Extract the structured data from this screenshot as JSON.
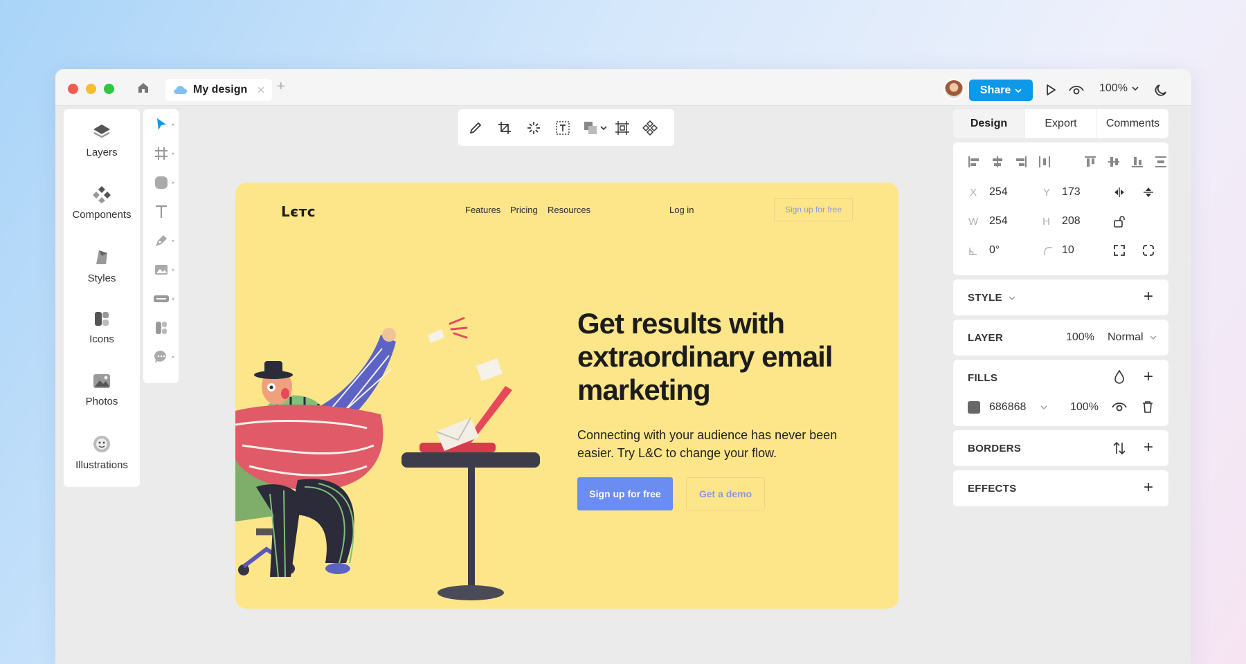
{
  "titlebar": {
    "tab_title": "My design",
    "share_label": "Share",
    "zoom": "100%"
  },
  "left_panel": {
    "items": [
      {
        "label": "Layers",
        "icon": "layers-icon"
      },
      {
        "label": "Components",
        "icon": "components-icon"
      },
      {
        "label": "Styles",
        "icon": "styles-icon"
      },
      {
        "label": "Icons",
        "icon": "icons-icon"
      },
      {
        "label": "Photos",
        "icon": "photos-icon"
      },
      {
        "label": "Illustrations",
        "icon": "illustrations-icon"
      }
    ]
  },
  "tools": [
    "select-tool",
    "frame-tool",
    "shape-tool",
    "text-tool",
    "pen-tool",
    "image-tool",
    "button-tool",
    "component-tool",
    "comment-tool"
  ],
  "canvas": {
    "logo": "Lєтс",
    "nav": [
      "Features",
      "Pricing",
      "Resources"
    ],
    "login": "Log in",
    "nav_signup": "Sign up for free",
    "headline": "Get results with extraordinary email marketing",
    "subtext": "Connecting with your audience has never been easier. Try L&C to change your flow.",
    "cta_primary": "Sign up for free",
    "cta_secondary": "Get a demo",
    "background_color": "#fde68a"
  },
  "right_panel": {
    "tabs": [
      "Design",
      "Export",
      "Comments"
    ],
    "x_label": "X",
    "x": "254",
    "y_label": "Y",
    "y": "173",
    "w_label": "W",
    "w": "254",
    "h_label": "H",
    "h": "208",
    "rotation": "0°",
    "radius": "10",
    "style_title": "STYLE",
    "layer_title": "LAYER",
    "layer_opacity": "100%",
    "blend_mode": "Normal",
    "fills_title": "FILLS",
    "fill_hex": "686868",
    "fill_opacity": "100%",
    "fill_color": "#686868",
    "borders_title": "BORDERS",
    "effects_title": "EFFECTS"
  },
  "colors": {
    "accent": "#0d99e8",
    "cta": "#6b8cf0"
  }
}
